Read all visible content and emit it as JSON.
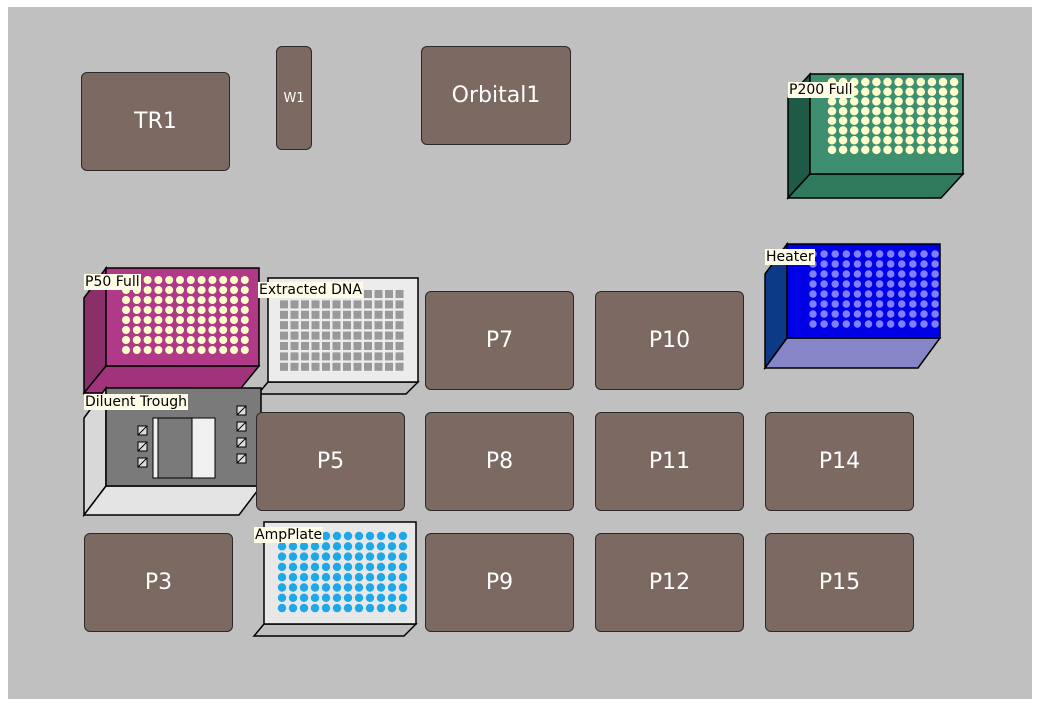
{
  "colors": {
    "position_fill": "#7b6962",
    "background": "#c0c0c0",
    "label_bg": "#fffde8"
  },
  "positions": {
    "tr1": "TR1",
    "w1": "W1",
    "orbital1": "Orbital1",
    "p3": "P3",
    "p5": "P5",
    "p7": "P7",
    "p8": "P8",
    "p9": "P9",
    "p10": "P10",
    "p11": "P11",
    "p12": "P12",
    "p14": "P14",
    "p15": "P15"
  },
  "labware": {
    "p200": "P200 Full",
    "p50": "P50 Full",
    "extracted_dna": "Extracted DNA",
    "heater": "Heater",
    "diluent_trough": "Diluent Trough",
    "ampplate": "AmpPlate"
  }
}
